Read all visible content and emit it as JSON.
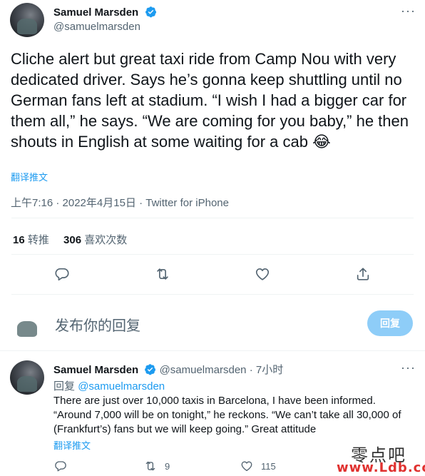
{
  "tweet": {
    "author_name": "Samuel Marsden",
    "author_handle": "@samuelmarsden",
    "text": "Cliche alert but great taxi ride from Camp Nou with very dedicated driver. Says he’s gonna keep shuttling until no German fans left at stadium. “I wish I had a bigger car for them all,” he says. “We are coming for you baby,” he then shouts in English at some waiting for a cab 😂",
    "translate_label": "翻译推文",
    "timestamp": "上午7:16 · 2022年4月15日 · Twitter for iPhone",
    "retweets_count": "16",
    "retweets_label": "转推",
    "likes_count": "306",
    "likes_label": "喜欢次数",
    "more_icon": "more-icon"
  },
  "actions": {
    "reply_icon": "comment-icon",
    "retweet_icon": "retweet-icon",
    "like_icon": "heart-icon",
    "share_icon": "share-icon"
  },
  "compose": {
    "placeholder": "发布你的回复",
    "button_label": "回复"
  },
  "reply": {
    "author_name": "Samuel Marsden",
    "author_handle": "@samuelmarsden",
    "time": "· 7小时",
    "replying_label": "回复",
    "replying_to": "@samuelmarsden",
    "text": "There are just over 10,000 taxis in Barcelona, I have been informed. “Around 7,000 will be on tonight,” he reckons. “We can’t take all 30,000 of (Frankfurt’s) fans but we will keep going.” Great attitude",
    "translate_label": "翻译推文",
    "retweets_count": "9",
    "likes_count": "115"
  },
  "watermark": {
    "cn": "零点吧",
    "url": "www.Ldb.cc"
  },
  "colors": {
    "accent": "#1d9bf0",
    "muted": "#536471",
    "button_disabled": "#8ecdf8"
  }
}
